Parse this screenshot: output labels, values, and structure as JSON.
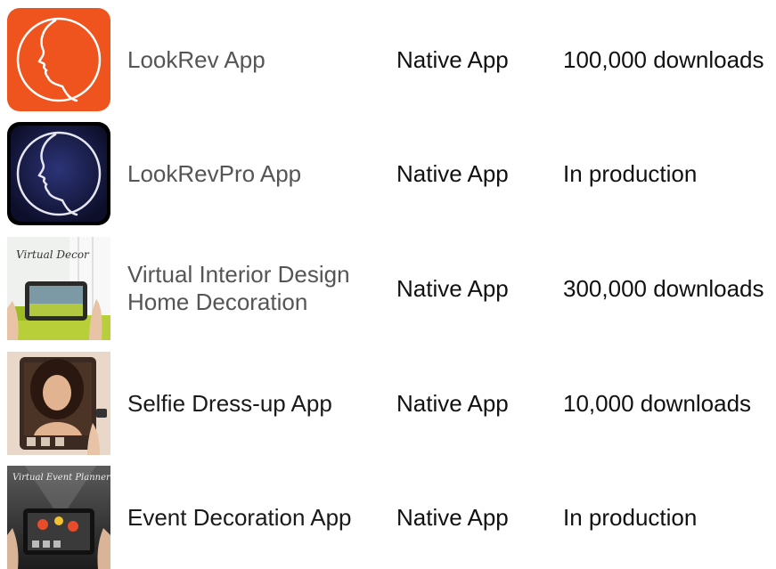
{
  "apps": [
    {
      "name_lines": [
        "LookRev App"
      ],
      "type": "Native App",
      "status": "100,000 downloads",
      "icon": "lookrev-face-icon",
      "icon_bg": "#f0541e"
    },
    {
      "name_lines": [
        "LookRevPro App"
      ],
      "type": "Native App",
      "status": "In production",
      "icon": "lookrevpro-face-icon",
      "icon_bg": "#1b1f4e"
    },
    {
      "name_lines": [
        "Virtual Interior Design",
        "Home Decoration"
      ],
      "type": "Native App",
      "status": "300,000 downloads",
      "icon": "virtual-decor-icon",
      "icon_caption": "Virtual Decor"
    },
    {
      "name_lines": [
        "Selfie Dress-up App"
      ],
      "type": "Native App",
      "status": "10,000 downloads",
      "icon": "selfie-dressup-icon"
    },
    {
      "name_lines": [
        "Event Decoration App"
      ],
      "type": "Native App",
      "status": "In production",
      "icon": "event-planner-icon",
      "icon_caption": "Virtual Event Planner"
    }
  ]
}
